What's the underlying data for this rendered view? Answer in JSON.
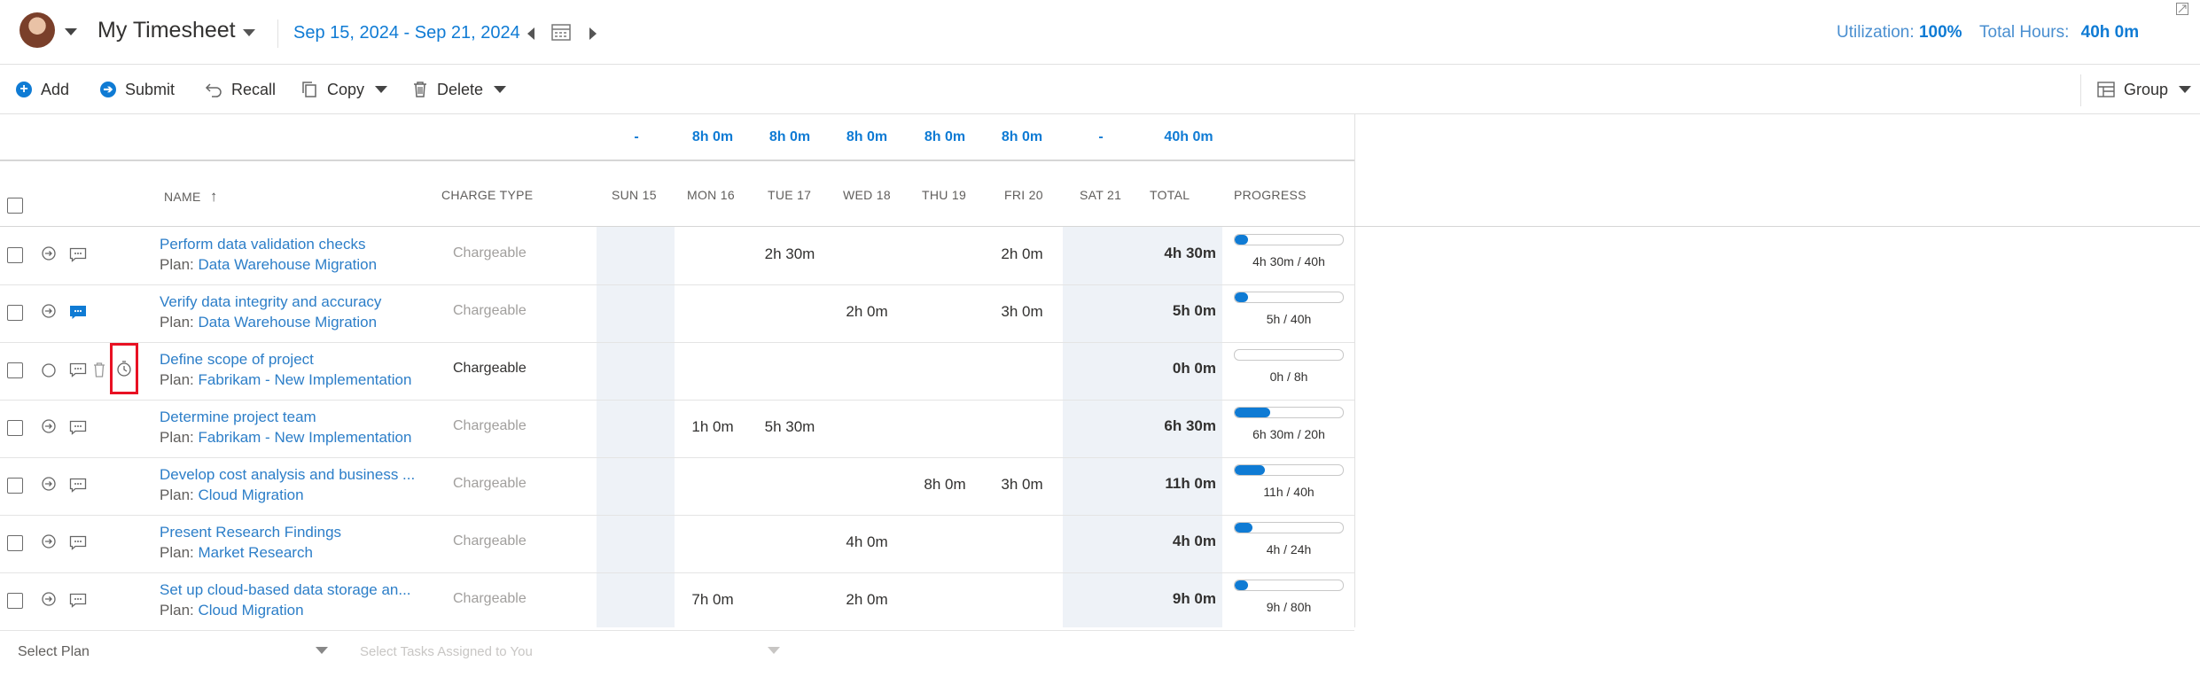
{
  "header": {
    "title": "My Timesheet",
    "date_range": "Sep 15, 2024 - Sep 21, 2024",
    "utilization_label": "Utilization:",
    "utilization_value": "100%",
    "total_hours_label": "Total Hours:",
    "total_hours_value": "40h 0m"
  },
  "toolbar": {
    "add": "Add",
    "submit": "Submit",
    "recall": "Recall",
    "copy": "Copy",
    "delete": "Delete",
    "group": "Group"
  },
  "day_totals": [
    "-",
    "8h 0m",
    "8h 0m",
    "8h 0m",
    "8h 0m",
    "8h 0m",
    "-"
  ],
  "grand_total": "40h 0m",
  "columns": {
    "name": "NAME",
    "charge_type": "CHARGE TYPE",
    "days": [
      "SUN 15",
      "MON 16",
      "TUE 17",
      "WED 18",
      "THU 19",
      "FRI 20",
      "SAT 21"
    ],
    "total": "TOTAL",
    "progress": "PROGRESS"
  },
  "plan_prefix": "Plan: ",
  "rows": [
    {
      "task": "Perform data validation checks",
      "plan": "Data Warehouse Migration",
      "charge": "Chargeable",
      "days": [
        "",
        "",
        "2h 30m",
        "",
        "",
        "2h 0m",
        ""
      ],
      "total": "4h 30m",
      "progress": 0.11,
      "progress_label": "4h 30m / 40h"
    },
    {
      "task": "Verify data integrity and accuracy",
      "plan": "Data Warehouse Migration",
      "charge": "Chargeable",
      "days": [
        "",
        "",
        "",
        "2h 0m",
        "",
        "3h 0m",
        ""
      ],
      "total": "5h 0m",
      "progress": 0.125,
      "progress_label": "5h / 40h"
    },
    {
      "task": "Define scope of project",
      "plan": "Fabrikam - New Implementation",
      "charge": "Chargeable",
      "days": [
        "",
        "",
        "",
        "",
        "",
        "",
        ""
      ],
      "total": "0h 0m",
      "progress": 0,
      "progress_label": "0h / 8h"
    },
    {
      "task": "Determine project team",
      "plan": "Fabrikam - New Implementation",
      "charge": "Chargeable",
      "days": [
        "",
        "1h 0m",
        "5h 30m",
        "",
        "",
        "",
        ""
      ],
      "total": "6h 30m",
      "progress": 0.325,
      "progress_label": "6h 30m / 20h"
    },
    {
      "task": "Develop cost analysis and business ...",
      "plan": "Cloud Migration",
      "charge": "Chargeable",
      "days": [
        "",
        "",
        "",
        "",
        "8h 0m",
        "3h 0m",
        ""
      ],
      "total": "11h 0m",
      "progress": 0.275,
      "progress_label": "11h / 40h"
    },
    {
      "task": "Present Research Findings",
      "plan": "Market Research",
      "charge": "Chargeable",
      "days": [
        "",
        "",
        "",
        "4h 0m",
        "",
        "",
        ""
      ],
      "total": "4h 0m",
      "progress": 0.167,
      "progress_label": "4h / 24h"
    },
    {
      "task": "Set up cloud-based data storage an...",
      "plan": "Cloud Migration",
      "charge": "Chargeable",
      "days": [
        "",
        "7h 0m",
        "",
        "2h 0m",
        "",
        "",
        ""
      ],
      "total": "9h 0m",
      "progress": 0.1125,
      "progress_label": "9h / 80h"
    }
  ],
  "footer": {
    "select_plan": "Select Plan",
    "select_tasks": "Select Tasks Assigned to You"
  },
  "colors": {
    "accent": "#0f7bd4",
    "highlight": "#e81123",
    "weekend_shade": "#eef2f7"
  }
}
